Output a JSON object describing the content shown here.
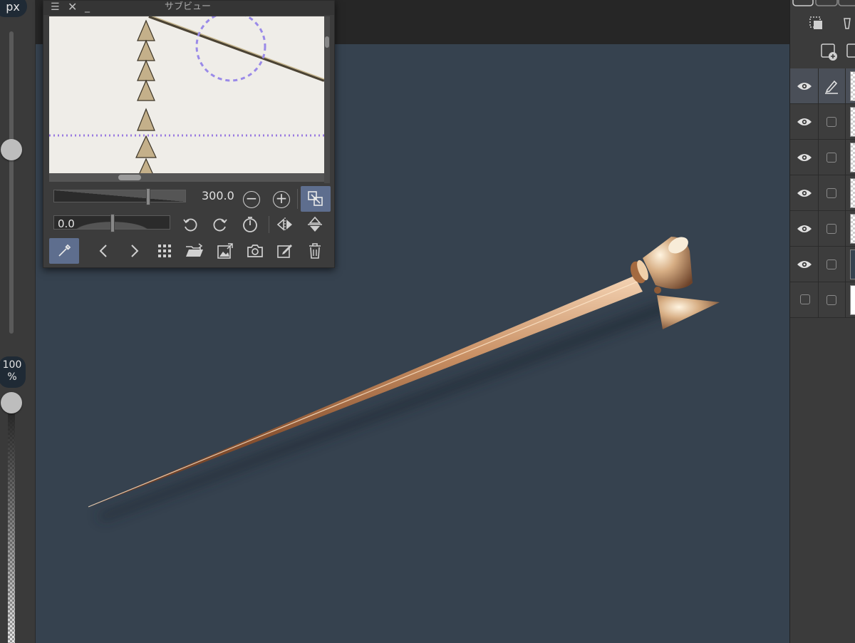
{
  "left_panel": {
    "unit": "px",
    "brush_size_level": 0.4,
    "opacity_percent": "100",
    "opacity_unit": "%"
  },
  "subview": {
    "title": "サブビュー",
    "zoom_value": "300.0",
    "rotation_value": "0.0",
    "accent_color": "#5e6e8e",
    "title_icons": [
      "menu-icon",
      "close-icon",
      "minimize-icon"
    ],
    "rotation_buttons": [
      "rotate-left-icon",
      "rotate-right-icon",
      "reset-rotation-icon",
      "flip-horizontal-icon",
      "flip-vertical-icon"
    ],
    "bottom_buttons": [
      "eyedropper-icon",
      "previous-icon",
      "next-icon",
      "grid-icon",
      "open-folder-icon",
      "import-image-icon",
      "camera-icon",
      "edit-icon",
      "trash-icon"
    ]
  },
  "layers": {
    "rows": [
      {
        "visible": true,
        "editing": true,
        "active": true
      },
      {
        "visible": true,
        "editing": false,
        "active": false
      },
      {
        "visible": true,
        "editing": false,
        "active": false
      },
      {
        "visible": true,
        "editing": false,
        "active": false
      },
      {
        "visible": true,
        "editing": false,
        "active": false
      },
      {
        "visible": true,
        "editing": false,
        "active": false
      },
      {
        "visible": false,
        "editing": false,
        "active": false
      }
    ]
  },
  "canvas": {
    "background_color": "#36424f",
    "subject": "brass-hairpin"
  }
}
